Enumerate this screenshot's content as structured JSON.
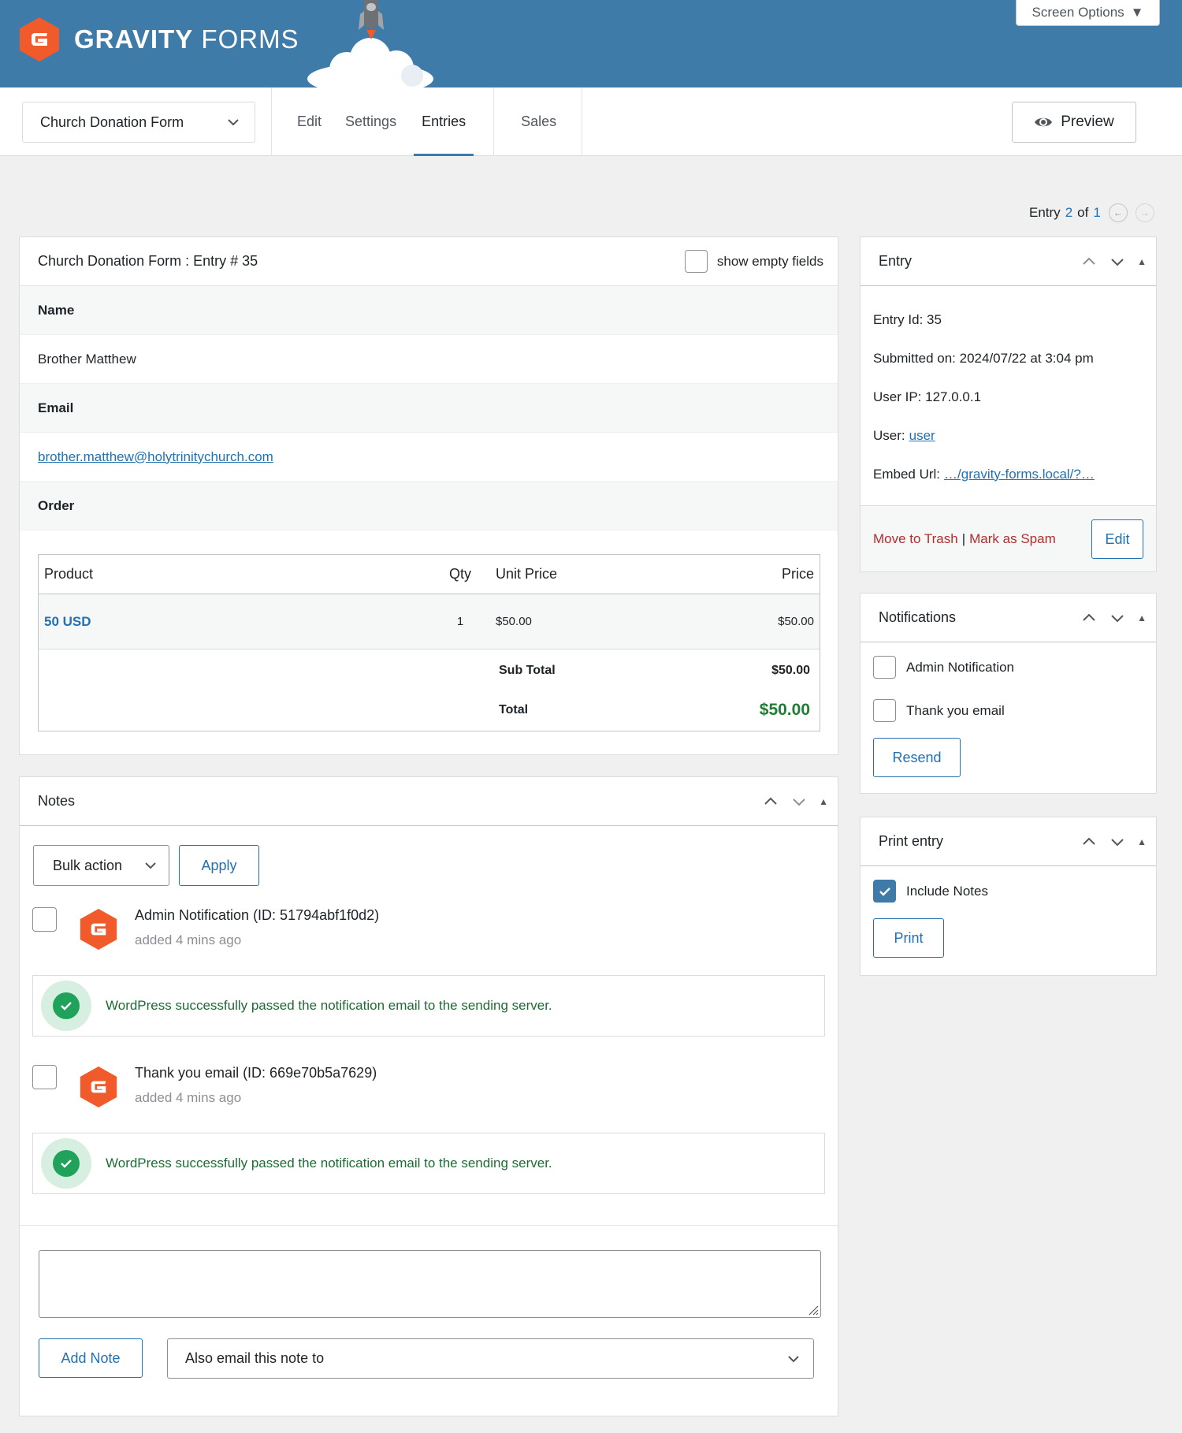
{
  "header": {
    "brand_bold": "GRAVITY",
    "brand_light": "FORMS",
    "screen_options": "Screen Options"
  },
  "toolbar": {
    "form_name": "Church Donation Form",
    "tabs": [
      {
        "label": "Edit"
      },
      {
        "label": "Settings"
      },
      {
        "label": "Entries"
      },
      {
        "label": "Sales"
      }
    ],
    "preview_label": "Preview"
  },
  "entry_nav": {
    "prefix": "Entry",
    "current": "2",
    "of": "of",
    "total": "1"
  },
  "entry_detail": {
    "title": "Church Donation Form : Entry # 35",
    "show_empty_label": "show empty fields",
    "fields": [
      {
        "label": "Name",
        "value": "Brother Matthew"
      },
      {
        "label": "Email",
        "value": "brother.matthew@holytrinitychurch.com"
      },
      {
        "label": "Order"
      }
    ],
    "order": {
      "headers": {
        "product": "Product",
        "qty": "Qty",
        "unit_price": "Unit Price",
        "price": "Price"
      },
      "row": {
        "product": "50 USD",
        "qty": "1",
        "unit_price": "$50.00",
        "price": "$50.00"
      },
      "subtotal_label": "Sub Total",
      "subtotal_value": "$50.00",
      "total_label": "Total",
      "total_value": "$50.00"
    }
  },
  "notes": {
    "title": "Notes",
    "bulk_action": "Bulk action",
    "apply": "Apply",
    "items": [
      {
        "title": "Admin Notification (ID: 51794abf1f0d2)",
        "time": "added 4 mins ago",
        "message": "WordPress successfully passed the notification email to the sending server."
      },
      {
        "title": "Thank you email (ID: 669e70b5a7629)",
        "time": "added 4 mins ago",
        "message": "WordPress successfully passed the notification email to the sending server."
      }
    ],
    "add_note": "Add Note",
    "email_select": "Also email this note to"
  },
  "entry_box": {
    "title": "Entry",
    "entry_id": "Entry Id: 35",
    "submitted": "Submitted on: 2024/07/22 at 3:04 pm",
    "user_ip": "User IP: 127.0.0.1",
    "user_label": "User:",
    "user_link": "user",
    "embed_label": "Embed Url:",
    "embed_link": "…/gravity-forms.local/?…",
    "trash": "Move to Trash",
    "separator": "|",
    "spam": "Mark as Spam",
    "edit": "Edit"
  },
  "notifications_box": {
    "title": "Notifications",
    "options": [
      {
        "label": "Admin Notification"
      },
      {
        "label": "Thank you email"
      }
    ],
    "resend": "Resend"
  },
  "print_box": {
    "title": "Print entry",
    "include_notes": "Include Notes",
    "print": "Print"
  },
  "colors": {
    "header_blue": "#3f7ba8",
    "brand_orange": "#f15a2b",
    "link_blue": "#2271b1",
    "success_green": "#21a25b",
    "danger_red": "#b32d2e"
  }
}
